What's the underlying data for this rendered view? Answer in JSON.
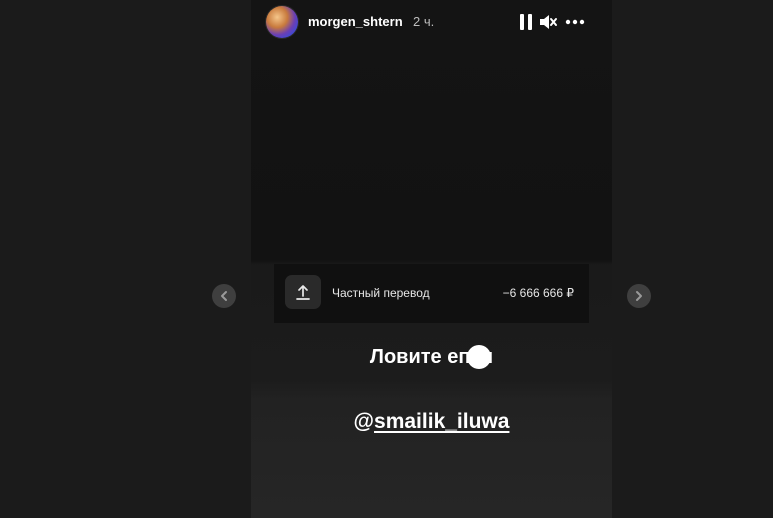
{
  "story": {
    "username": "morgen_shtern",
    "time_ago": "2 ч.",
    "controls": {
      "pause_icon": "pause-icon",
      "mute_icon": "mute-icon",
      "more_icon": "more-icon"
    }
  },
  "transfer": {
    "label": "Частный перевод",
    "amount": "−6 666 666 ₽",
    "icon": "upload-arrow-icon"
  },
  "caption": "Ловите еп  ы",
  "mention": {
    "at": "@",
    "handle": "smailik_iluwa"
  },
  "nav": {
    "prev_icon": "chevron-left-icon",
    "next_icon": "chevron-right-icon"
  }
}
